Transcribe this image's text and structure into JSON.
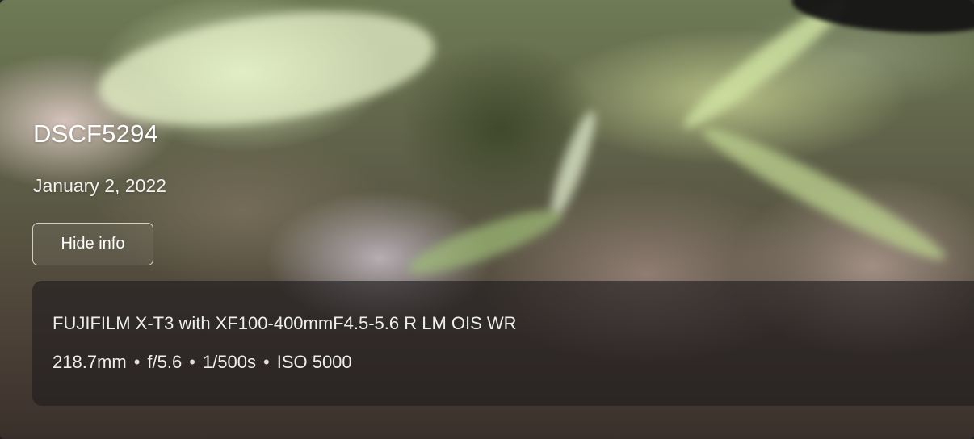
{
  "photo": {
    "title": "DSCF5294",
    "date": "January 2, 2022",
    "hide_info_label": "Hide info"
  },
  "info": {
    "camera": "FUJIFILM X-T3 with XF100-400mmF4.5-5.6 R LM OIS WR",
    "focal_length": "218.7mm",
    "aperture": "f/5.6",
    "shutter": "1/500s",
    "iso": "ISO 5000",
    "separator": "•"
  }
}
